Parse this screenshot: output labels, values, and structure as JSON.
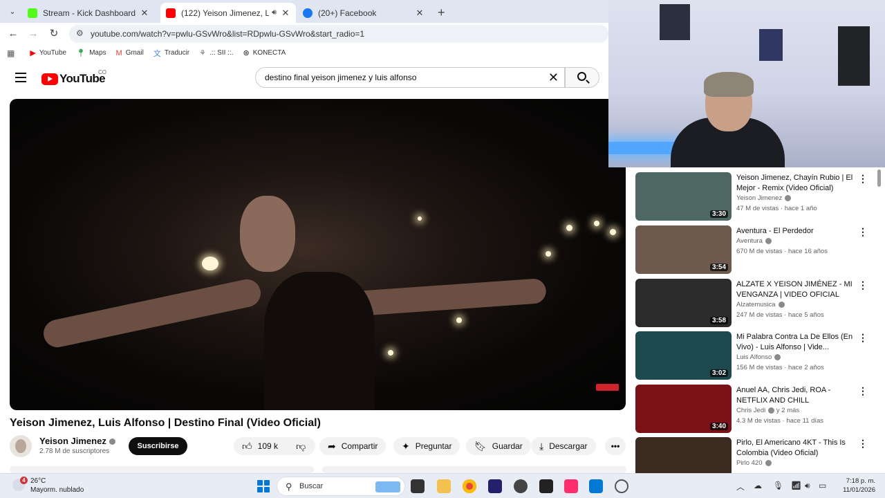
{
  "browser": {
    "tabs": [
      {
        "title": "Stream - Kick Dashboard",
        "favicon_color": "#53fc18"
      },
      {
        "title": "(122) Yeison Jimenez, Luis A",
        "favicon_color": "#ff0000"
      },
      {
        "title": "(20+) Facebook",
        "favicon_color": "#1877f2"
      }
    ],
    "url": "youtube.com/watch?v=pwlu-GSvWro&list=RDpwlu-GSvWro&start_radio=1",
    "bookmarks": [
      {
        "label": "YouTube",
        "icon": "youtube-icon"
      },
      {
        "label": "Maps",
        "icon": "maps-pin-icon"
      },
      {
        "label": "Gmail",
        "icon": "gmail-icon"
      },
      {
        "label": "Traducir",
        "icon": "translate-icon"
      },
      {
        "label": ".:: SII ::.",
        "icon": "sii-icon"
      },
      {
        "label": "KONECTA",
        "icon": "konecta-icon"
      }
    ]
  },
  "youtube": {
    "logo_text": "YouTube",
    "country_code": "CO",
    "search_query": "destino final yeison jimenez y luis alfonso"
  },
  "video": {
    "title": "Yeison Jimenez, Luis Alfonso | Destino Final (Video Oficial)",
    "channel": "Yeison Jimenez",
    "subscribers": "2.78 M de suscriptores",
    "subscribe_label": "Suscribirse",
    "likes": "109 k",
    "share_label": "Compartir",
    "ask_label": "Preguntar",
    "save_label": "Guardar",
    "download_label": "Descargar"
  },
  "recommendations": [
    {
      "title": "Yeison Jimenez, Chayín Rubio | El Mejor - Remix (Video Oficial)",
      "channel": "Yeison Jimenez",
      "meta": "47 M de vistas · hace 1 año",
      "duration": "3:30",
      "thumb_color": "#4d6763"
    },
    {
      "title": "Aventura - El Perdedor",
      "channel": "Aventura",
      "meta": "670 M de vistas · hace 16 años",
      "duration": "3:54",
      "thumb_color": "#6e5a4d"
    },
    {
      "title": "ALZATE X YEISON JIMÉNEZ - MI VENGANZA | VIDEO OFICIAL",
      "channel": "Alzatemusica",
      "meta": "247 M de vistas · hace 5 años",
      "duration": "3:58",
      "thumb_color": "#2b2b2b"
    },
    {
      "title": "Mi Palabra Contra La De Ellos (En Vivo) - Luis Alfonso | Vide...",
      "channel": "Luis Alfonso",
      "meta": "156 M de vistas · hace 2 años",
      "duration": "3:02",
      "thumb_color": "#1d4a4e"
    },
    {
      "title": "Anuel AA, Chris Jedi, ROA - NETFLIX AND CHILL",
      "channel": "Chris Jedi",
      "channel_extra": "y 2 más",
      "meta": "4.3 M de vistas · hace 11 días",
      "duration": "3:40",
      "thumb_color": "#7a1218"
    },
    {
      "title": "Pirlo, El Americano 4KT - This Is Colombia (Video Oficial)",
      "channel": "Pirlo 420",
      "meta": "",
      "duration": "",
      "thumb_color": "#3a2a1f"
    }
  ],
  "taskbar": {
    "weather_temp": "26°C",
    "weather_desc": "Mayorm. nublado",
    "weather_badge": "4",
    "search_label": "Buscar",
    "time": "7:18 p. m.",
    "date": "11/01/2026"
  },
  "colors": {
    "yt_red": "#ff0000",
    "win_blue": "#0078d4"
  }
}
